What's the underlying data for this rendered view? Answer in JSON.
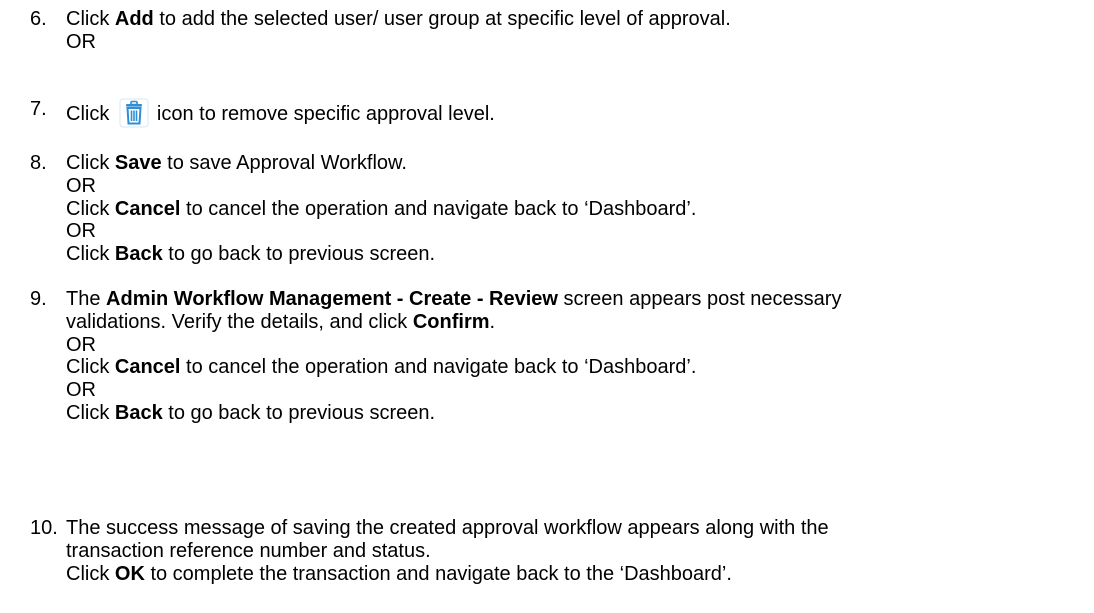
{
  "step6": {
    "num": "6.",
    "pre": "Click ",
    "bold": "Add",
    "post": " to add the selected user/ user group at specific level of approval.",
    "or": "OR"
  },
  "step7": {
    "num": "7.",
    "pre": "Click",
    "icon": "trash-icon",
    "post": "icon to remove specific approval level."
  },
  "step8": {
    "num": "8.",
    "l1_pre": "Click ",
    "l1_bold": "Save",
    "l1_post": " to save Approval Workflow.",
    "or1": "OR",
    "l2_pre": "Click ",
    "l2_bold": "Cancel",
    "l2_post": " to cancel the operation and navigate back to ‘Dashboard’.",
    "or2": "OR",
    "l3_pre": "Click ",
    "l3_bold": "Back",
    "l3_post": " to go back to previous screen."
  },
  "step9": {
    "num": "9.",
    "l1_pre": "The ",
    "l1_bold": "Admin Workflow Management - Create - Review",
    "l1_post": " screen appears post necessary",
    "l2_pre": "validations. Verify the details, and click ",
    "l2_bold": "Confirm",
    "l2_post": ".",
    "or1": "OR",
    "l3_pre": "Click ",
    "l3_bold": "Cancel",
    "l3_post": " to cancel the operation and navigate back to ‘Dashboard’.",
    "or2": "OR",
    "l4_pre": "Click ",
    "l4_bold": "Back",
    "l4_post": " to go back to previous screen."
  },
  "step10": {
    "num": "10.",
    "l1": "The success message of saving the created approval workflow appears along with the",
    "l2": "transaction reference number and status.",
    "l3_pre": "Click ",
    "l3_bold": "OK",
    "l3_post": " to complete the transaction and navigate back to the ‘Dashboard’."
  },
  "colors": {
    "text": "#000000",
    "icon_blue": "#2e8fd8"
  }
}
